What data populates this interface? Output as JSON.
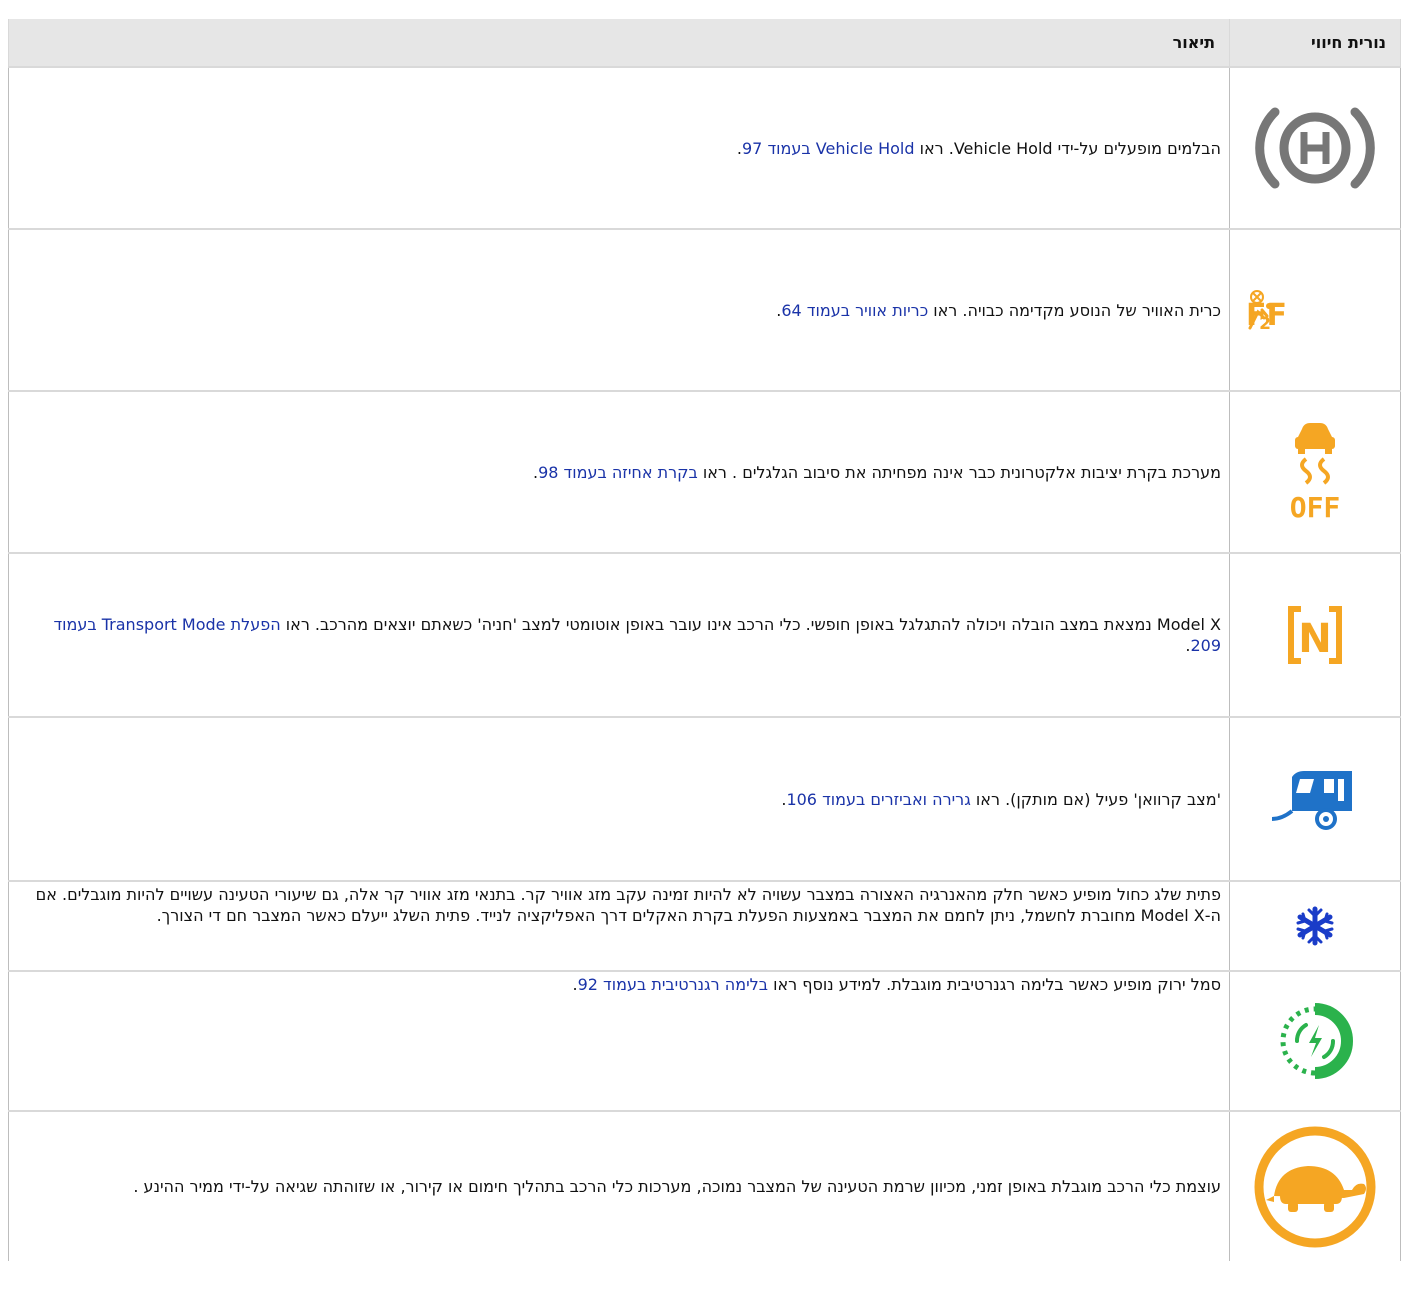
{
  "header": {
    "col_icon": "נורית חיווי",
    "col_desc": "תיאור"
  },
  "rows": [
    {
      "icon": "vehicle-hold-icon",
      "text": "הבלמים מופעלים על-ידי Vehicle Hold. ראו ",
      "link": "Vehicle Hold בעמוד 97",
      "tail": "."
    },
    {
      "icon": "passenger-airbag-off-icon",
      "icon_text": "OFF",
      "icon_sub": "2",
      "text": "כרית האוויר של הנוסע מקדימה כבויה. ראו ",
      "link": "כריות אוויר בעמוד 64",
      "tail": "."
    },
    {
      "icon": "traction-control-off-icon",
      "icon_text": "OFF",
      "text": "מערכת בקרת יציבות אלקטרונית כבר אינה מפחיתה את סיבוב הגלגלים . ראו ",
      "link": "בקרת אחיזה בעמוד 98",
      "tail": "."
    },
    {
      "icon": "transport-mode-icon",
      "icon_text": "N",
      "text": "Model X נמצאת במצב הובלה ויכולה להתגלגל באופן חופשי. כלי הרכב אינו עובר באופן אוטומטי למצב 'חניה' כשאתם יוצאים מהרכב. ראו ",
      "link": "הפעלת Transport Mode בעמוד 209",
      "tail": "."
    },
    {
      "icon": "trailer-mode-icon",
      "text": "'מצב קרוואן' פעיל (אם מותקן). ראו ",
      "link": "גרירה ואביזרים בעמוד 106",
      "tail": "."
    },
    {
      "icon": "snowflake-icon",
      "text": "פתית שלג כחול מופיע כאשר חלק מהאנרגיה האצורה במצבר עשויה לא להיות זמינה עקב מזג אוויר קר. בתנאי מזג אוויר קר אלה, גם שיעורי הטעינה עשויים להיות מוגבלים. אם ה-Model X מחוברת לחשמל, ניתן לחמם את המצבר באמצעות הפעלת בקרת האקלים דרך האפליקציה לנייד. פתית השלג ייעלם כאשר המצבר חם די הצורך."
    },
    {
      "icon": "regen-braking-limited-icon",
      "text": "סמל ירוק מופיע כאשר בלימה רגנרטיבית מוגבלת. למידע נוסף ראו ",
      "link": "בלימה רגנרטיבית בעמוד 92",
      "tail": "."
    },
    {
      "icon": "turtle-icon",
      "text": "עוצמת כלי הרכב מוגבלת באופן זמני, מכיוון שרמת הטעינה של המצבר נמוכה, מערכות כלי הרכב בתהליך חימום או קירור, או שזוהתה שגיאה על-ידי ממיר ההינע ."
    }
  ],
  "colors": {
    "gray": "#777777",
    "amber": "#f5a623",
    "blue": "#1f72c8",
    "navy": "#1a3cc8",
    "green": "#2bb24c",
    "orange": "#f5a623",
    "link": "#1a33a8",
    "header_bg": "#e6e6e6"
  }
}
